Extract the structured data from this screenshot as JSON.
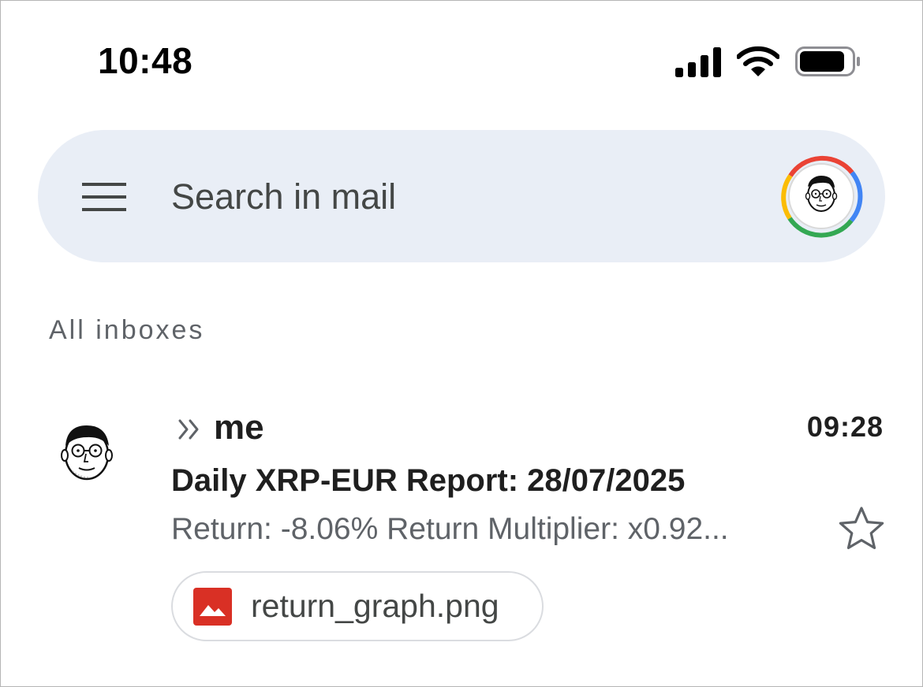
{
  "status_bar": {
    "time": "10:48",
    "icons": [
      "cellular-signal-icon",
      "wifi-icon",
      "battery-icon"
    ]
  },
  "search": {
    "menu_icon": "hamburger-menu-icon",
    "placeholder": "Search in mail",
    "account_icon": "account-avatar-icon",
    "ring_colors": [
      "#ea4335",
      "#fbbc04",
      "#34a853",
      "#4285f4"
    ],
    "background": "#e9eef6"
  },
  "section": {
    "title": "All inboxes"
  },
  "mails": [
    {
      "avatar_icon": "sender-avatar-icon",
      "importance_icon": "importance-marker-icon",
      "sender": "me",
      "time": "09:28",
      "subject": "Daily XRP-EUR Report: 28/07/2025",
      "snippet": "Return: -8.06% Return Multiplier: x0.92...",
      "starred": false,
      "attachment": {
        "icon": "image-file-icon",
        "icon_color": "#d93025",
        "name": "return_graph.png"
      }
    }
  ]
}
